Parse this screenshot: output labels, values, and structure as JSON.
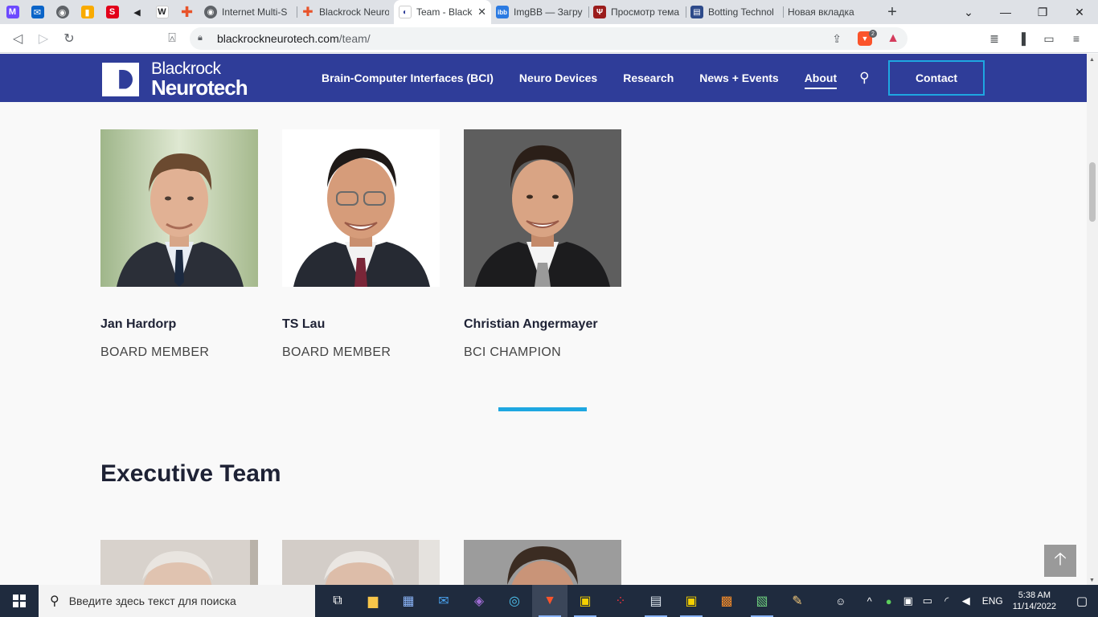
{
  "browser": {
    "tabs": [
      {
        "title": "Internet Multi-S",
        "color": "#5f6368",
        "glyph": "◉"
      },
      {
        "title": "Blackrock Neuro",
        "color": "#e8532a",
        "glyph": "+"
      },
      {
        "title": "Team - Black",
        "color": "#2f3d99",
        "glyph": "◐"
      },
      {
        "title": "ImgBB — Загру",
        "color": "#2a7ae2",
        "glyph": "ibb"
      },
      {
        "title": "Просмотр тема",
        "color": "#9b1c1c",
        "glyph": "Ψ"
      },
      {
        "title": "Botting Technol",
        "color": "#2d4a8a",
        "glyph": "▤"
      },
      {
        "title": "Новая вкладка",
        "color": "",
        "glyph": ""
      }
    ],
    "new_tab": "+",
    "url_host": "blackrockneurotech.com",
    "url_path": "/team/",
    "brave_badge": "2"
  },
  "site": {
    "logo_line1": "Blackrock",
    "logo_line2": "Neurotech",
    "nav": {
      "bci": "Brain-Computer Interfaces (BCI)",
      "devices": "Neuro Devices",
      "research": "Research",
      "news": "News + Events",
      "about": "About"
    },
    "contact": "Contact"
  },
  "board": [
    {
      "name": "Jan Hardorp",
      "role": "BOARD MEMBER"
    },
    {
      "name": "TS Lau",
      "role": "BOARD MEMBER"
    },
    {
      "name": "Christian Angermayer",
      "role": "BCI CHAMPION"
    }
  ],
  "executive": {
    "title": "Executive Team"
  },
  "taskbar": {
    "search_placeholder": "Введите здесь текст для поиска",
    "lang": "ENG",
    "time": "5:38 AM",
    "date": "11/14/2022"
  },
  "colors": {
    "header_bg": "#2f3d99",
    "accent": "#1ea7e1"
  }
}
